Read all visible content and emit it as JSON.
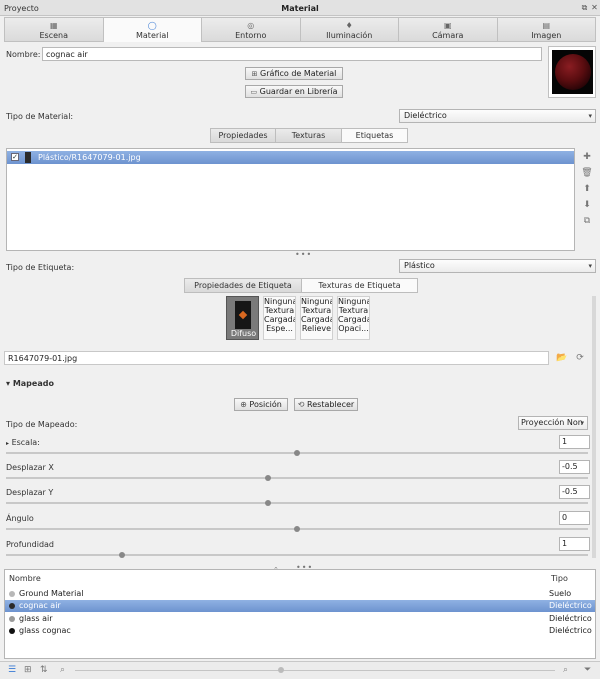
{
  "window": {
    "project": "Proyecto",
    "title": "Material"
  },
  "tabs": [
    {
      "label": "Escena",
      "icon": "scene-icon"
    },
    {
      "label": "Material",
      "icon": "material-icon"
    },
    {
      "label": "Entorno",
      "icon": "environment-icon"
    },
    {
      "label": "Iluminación",
      "icon": "light-icon"
    },
    {
      "label": "Cámara",
      "icon": "camera-icon"
    },
    {
      "label": "Imagen",
      "icon": "image-icon"
    }
  ],
  "name": {
    "label": "Nombre:",
    "value": "cognac air"
  },
  "buttons": {
    "graph": "Gráfico de Material",
    "save": "Guardar en Librería"
  },
  "material_type": {
    "label": "Tipo de Material:",
    "value": "Dieléctrico"
  },
  "subtabs": [
    "Propiedades",
    "Texturas",
    "Etiquetas"
  ],
  "labels_list": [
    {
      "text": "Plástico/R1647079-01.jpg",
      "checked": true
    }
  ],
  "label_type": {
    "label": "Tipo de Etiqueta:",
    "value": "Plástico"
  },
  "label_tabs": [
    "Propiedades de Etiqueta",
    "Texturas de Etiqueta"
  ],
  "textures": [
    {
      "lines": [
        "Difuso"
      ]
    },
    {
      "lines": [
        "Ninguna",
        "Textura",
        "Cargada",
        "Espe..."
      ]
    },
    {
      "lines": [
        "Ninguna",
        "Textura",
        "Cargada",
        "Relieve"
      ]
    },
    {
      "lines": [
        "Ninguna",
        "Textura",
        "Cargada",
        "Opaci..."
      ]
    }
  ],
  "file": {
    "value": "R1647079-01.jpg"
  },
  "mapping": {
    "header": "Mapeado",
    "position_btn": "Posición",
    "reset_btn": "Restablecer",
    "type_label": "Tipo de Mapeado:",
    "type_value": "Proyección Non",
    "fields": [
      {
        "label": "Escala:",
        "value": "1",
        "level": 0.5
      },
      {
        "label": "Desplazar X",
        "value": "-0.5",
        "level": 0.45
      },
      {
        "label": "Desplazar Y",
        "value": "-0.5",
        "level": 0.45
      },
      {
        "label": "Ángulo",
        "value": "0",
        "level": 0.5
      },
      {
        "label": "Profundidad",
        "value": "1",
        "level": 0.2
      }
    ]
  },
  "material_list": {
    "headers": {
      "name": "Nombre",
      "type": "Tipo"
    },
    "rows": [
      {
        "name": "Ground Material",
        "type": "Suelo",
        "color": "#b8b8b8",
        "selected": false
      },
      {
        "name": "cognac air",
        "type": "Dieléctrico",
        "color": "#2a2a2a",
        "selected": true
      },
      {
        "name": "glass air",
        "type": "Dieléctrico",
        "color": "#9a9a9a",
        "selected": false
      },
      {
        "name": "glass cognac",
        "type": "Dieléctrico",
        "color": "#111111",
        "selected": false
      }
    ]
  },
  "colors": {
    "selection": "#7096d0",
    "accent": "#3a7bd5",
    "preview": "#5a0d10"
  }
}
